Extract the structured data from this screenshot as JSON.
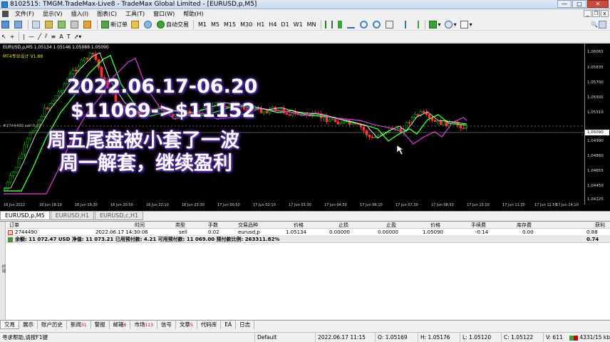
{
  "window": {
    "title": "8102515: TMGM.TradeMax-Live8 - TradeMax Global Limited - [EURUSD,p,M5]",
    "buttons": [
      "—",
      "□",
      "✕"
    ]
  },
  "menu": {
    "items": [
      "文件(F)",
      "显示(V)",
      "插入(I)",
      "图表(C)",
      "工具(T)",
      "窗口(W)",
      "帮助(H)"
    ],
    "mdi_buttons": [
      "_",
      "❐",
      "x"
    ]
  },
  "toolbar1": {
    "new_order": "新订单",
    "auto_trading": "自动交易",
    "timeframes": [
      "M1",
      "M5",
      "M15",
      "M30",
      "H1",
      "H4",
      "D1",
      "W1",
      "MN"
    ]
  },
  "chart": {
    "header": "EURUSD,p,M5  1.05134 1.05146 1.05088 1.05090",
    "indicator": "MT4专业设计 V1.88",
    "order_line_label": "#2744490 sell 0.02",
    "price_labels": [
      "1.06065",
      "1.05835",
      "1.05700",
      "1.05500",
      "1.05310",
      "1.05090",
      "1.04990",
      "1.04860",
      "1.04655",
      "1.04450",
      "1.04325"
    ],
    "current_price": "1.05090",
    "time_labels": [
      "16 Jun 2022",
      "16 Jun 18:10",
      "16 Jun 19:30",
      "16 Jun 20:50",
      "16 Jun 22:10",
      "16 Jun 23:30",
      "17 Jun 00:50",
      "17 Jun 02:10",
      "17 Jun 03:30",
      "17 Jun 04:50",
      "17 Jun 06:10",
      "17 Jun 07:30",
      "17 Jun 08:50",
      "17 Jun 10:10",
      "17 Jun 11:30",
      "17 Jun 12:50",
      "17 Jun 14:10"
    ],
    "colors": {
      "background": "#000000",
      "up_candle": "#00c000",
      "down_candle": "#ff3030",
      "ma_white": "#ffffff",
      "ma_green": "#33ff33",
      "ma_magenta": "#cc33cc"
    }
  },
  "overlay": {
    "line1": "2022.06.17-06.20",
    "line2": "$11069->$11152",
    "line3": "周五尾盘被小套了一波",
    "line4": "周一解套，继续盈利"
  },
  "chart_tabs": [
    "EURUSD,p,M5",
    "EURUSD,H1",
    "EURUSD,c,H1"
  ],
  "terminal": {
    "side_label": "终端",
    "columns": [
      "订单",
      "时间",
      "类型",
      "手数",
      "交易品种",
      "价格",
      "止损",
      "止盈",
      "价格",
      "手续费",
      "库存费",
      "获利"
    ],
    "rows": [
      {
        "order": "2744490",
        "time": "2022.06.17 14:30:06",
        "type": "sell",
        "lots": "0.02",
        "symbol": "eurusd,p",
        "open_price": "1.05134",
        "sl": "0.00000",
        "tp": "0.00000",
        "price": "1.05090",
        "commission": "-0.14",
        "swap": "0.00",
        "profit": "0.88"
      }
    ],
    "balance_line": "余额: 11 072.47 USD  净值: 11 073.21  已用预付款: 4.21  可用预付款: 11 069.00  预付款比例: 263311.82%",
    "balance_profit": "0.74"
  },
  "terminal_tabs": [
    {
      "label": "交易",
      "count": ""
    },
    {
      "label": "展示",
      "count": ""
    },
    {
      "label": "账户历史",
      "count": ""
    },
    {
      "label": "新闻",
      "count": "31"
    },
    {
      "label": "警报",
      "count": ""
    },
    {
      "label": "邮箱",
      "count": "6"
    },
    {
      "label": "市场",
      "count": "113"
    },
    {
      "label": "信号",
      "count": ""
    },
    {
      "label": "文章",
      "count": "5"
    },
    {
      "label": "代码库",
      "count": ""
    },
    {
      "label": "EA",
      "count": ""
    },
    {
      "label": "日志",
      "count": ""
    }
  ],
  "status": {
    "help": "寻求帮助,请按F1键",
    "profile": "Default",
    "datetime": "2022.06.17 11:15",
    "open": "O: 1.05169",
    "high": "H: 1.05176",
    "low": "L: 1.05120",
    "close": "C: 1.05122",
    "volume": "V: 611",
    "traffic": "4331/15 kb"
  }
}
